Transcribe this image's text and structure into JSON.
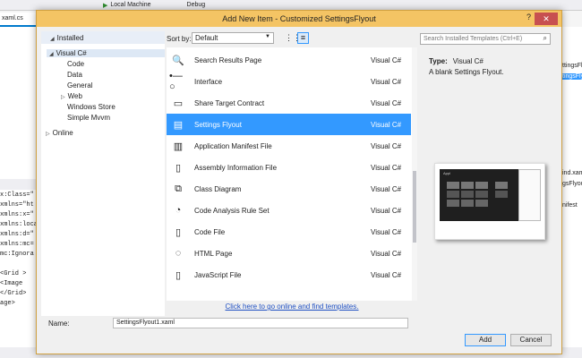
{
  "ide": {
    "toolbar": {
      "run_target": "Local Machine",
      "config": "Debug"
    },
    "tab_label": "xaml.cs",
    "code_lines": [
      "x:Class=\"",
      "xmlns=\"ht",
      "xmlns:x=\"",
      "xmlns:loca",
      "xmlns:d=\"",
      "xmlns:mc=",
      "mc:Ignora",
      "",
      "<Grid >",
      "    <Image",
      "</Grid>",
      "age>"
    ],
    "right_lines": [
      "ttingsFlyout",
      "tingsFlyout",
      "",
      "",
      "",
      "",
      "",
      "",
      "",
      "",
      "ind.xaml",
      "gsFlyout",
      "",
      "nifest"
    ]
  },
  "dialog": {
    "title": "Add New Item - Customized SettingsFlyout",
    "help": "?",
    "close": "✕",
    "installed_header": "Installed",
    "tree": {
      "visual_csharp": "Visual C#",
      "code": "Code",
      "data": "Data",
      "general": "General",
      "web": "Web",
      "windows_store": "Windows Store",
      "simple_mvvm": "Simple Mvvm",
      "online": "Online"
    },
    "sort_label": "Sort by:",
    "sort_value": "Default",
    "search_placeholder": "Search Installed Templates (Ctrl+E)",
    "items": [
      {
        "name": "Search Results Page",
        "lang": "Visual C#",
        "icon": "search-page-icon",
        "glyph": "🔍"
      },
      {
        "name": "Interface",
        "lang": "Visual C#",
        "icon": "interface-icon",
        "glyph": "•—○"
      },
      {
        "name": "Share Target Contract",
        "lang": "Visual C#",
        "icon": "share-target-icon",
        "glyph": "▭"
      },
      {
        "name": "Settings Flyout",
        "lang": "Visual C#",
        "icon": "settings-flyout-icon",
        "glyph": "▤"
      },
      {
        "name": "Application Manifest File",
        "lang": "Visual C#",
        "icon": "manifest-file-icon",
        "glyph": "▥"
      },
      {
        "name": "Assembly Information File",
        "lang": "Visual C#",
        "icon": "assembly-info-icon",
        "glyph": "▯"
      },
      {
        "name": "Class Diagram",
        "lang": "Visual C#",
        "icon": "class-diagram-icon",
        "glyph": "⧉"
      },
      {
        "name": "Code Analysis Rule Set",
        "lang": "Visual C#",
        "icon": "rule-set-icon",
        "glyph": "◔"
      },
      {
        "name": "Code File",
        "lang": "Visual C#",
        "icon": "code-file-icon",
        "glyph": "▯"
      },
      {
        "name": "HTML Page",
        "lang": "Visual C#",
        "icon": "html-page-icon",
        "glyph": "◌"
      },
      {
        "name": "JavaScript File",
        "lang": "Visual C#",
        "icon": "javascript-file-icon",
        "glyph": "▯"
      }
    ],
    "selected_index": 3,
    "online_link": "Click here to go online and find templates.",
    "detail": {
      "type_label": "Type:",
      "type_value": "Visual C#",
      "description": "A blank Settings Flyout.",
      "preview_app_title": "Appl"
    },
    "name_label": "Name:",
    "name_value": "SettingsFlyout1.xaml",
    "add_label": "Add",
    "cancel_label": "Cancel"
  },
  "colors": {
    "title_bar": "#f4c464",
    "selection": "#3399ff",
    "link": "#1e4fc2",
    "close": "#c75050"
  }
}
